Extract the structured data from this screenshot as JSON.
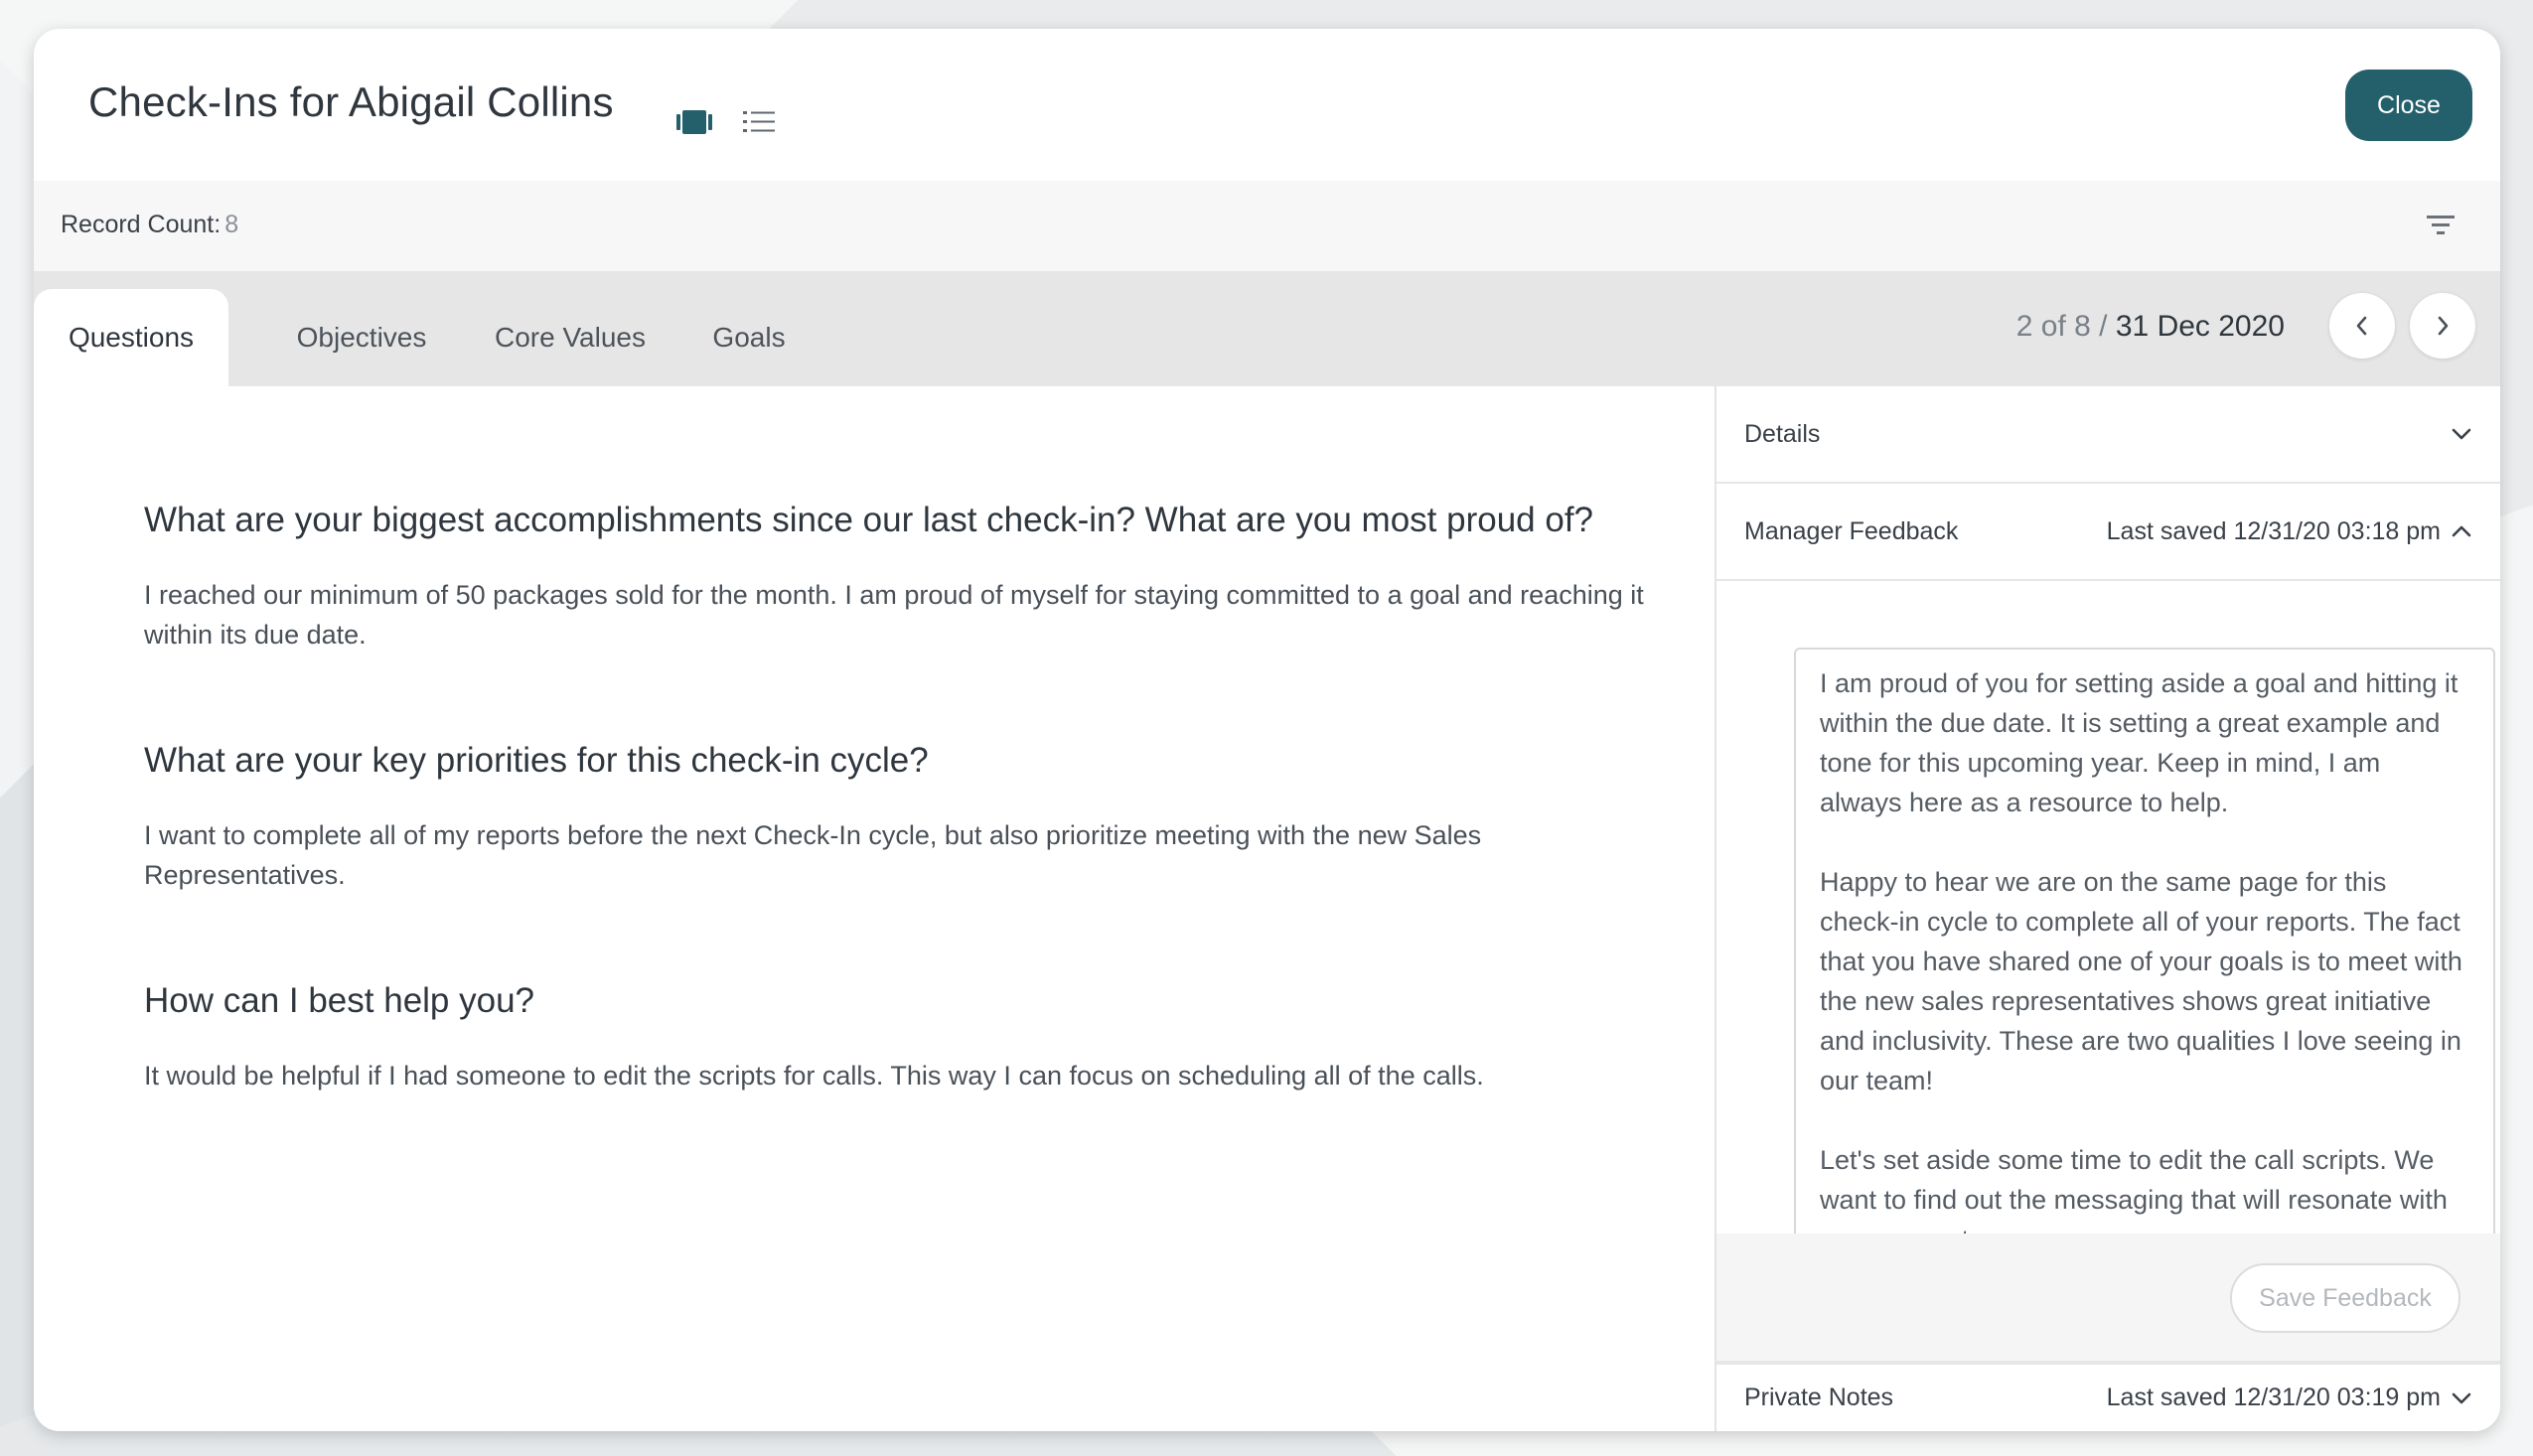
{
  "header": {
    "title": "Check-Ins for Abigail Collins",
    "close_label": "Close",
    "icons": [
      "card-view-icon",
      "list-view-icon"
    ]
  },
  "record_bar": {
    "label": "Record Count:",
    "count": "8",
    "filter_icon": "filter-icon"
  },
  "tabs": [
    {
      "label": "Questions",
      "active": true
    },
    {
      "label": "Objectives",
      "active": false
    },
    {
      "label": "Core Values",
      "active": false
    },
    {
      "label": "Goals",
      "active": false
    }
  ],
  "pager": {
    "position": "2 of 8 /",
    "date": "31 Dec 2020",
    "prev_icon": "chevron-left-icon",
    "next_icon": "chevron-right-icon"
  },
  "questions": [
    {
      "question": "What are your biggest accomplishments since our last check-in? What are you most proud of?",
      "answer": "I reached our minimum of 50 packages sold for the month. I am proud of myself for staying committed to a goal and reaching it within its due date."
    },
    {
      "question": "What are your key priorities for this check-in cycle?",
      "answer": "I want to complete all of my reports before the next Check-In cycle, but also prioritize meeting with the new Sales Representatives."
    },
    {
      "question": "How can I best help you?",
      "answer": "It would be helpful if I had someone to edit the scripts for calls. This way I can focus on scheduling all of the calls."
    }
  ],
  "side_panel": {
    "details_label": "Details",
    "manager_feedback": {
      "label": "Manager Feedback",
      "saved": "Last saved 12/31/20 03:18 pm",
      "text": "I am proud of you for setting aside a goal and hitting it within the due date. It is setting a great example and tone for this upcoming year. Keep in mind, I am always here as a resource to help.\n\nHappy to hear we are on the same page for this check-in cycle to complete all of your reports. The fact that you have shared one of your goals is to meet with the new sales representatives shows great initiative and inclusivity. These are two qualities I love seeing in our team!\n\nLet's set aside some time to edit the call scripts. We want to find out the messaging that will resonate with our prospects."
    },
    "save_label": "Save Feedback",
    "private_notes": {
      "label": "Private Notes",
      "saved": "Last saved 12/31/20 03:19 pm"
    }
  },
  "colors": {
    "accent": "#24606b",
    "tab_bar": "#e6e6e6",
    "record_bar": "#f7f7f7"
  }
}
